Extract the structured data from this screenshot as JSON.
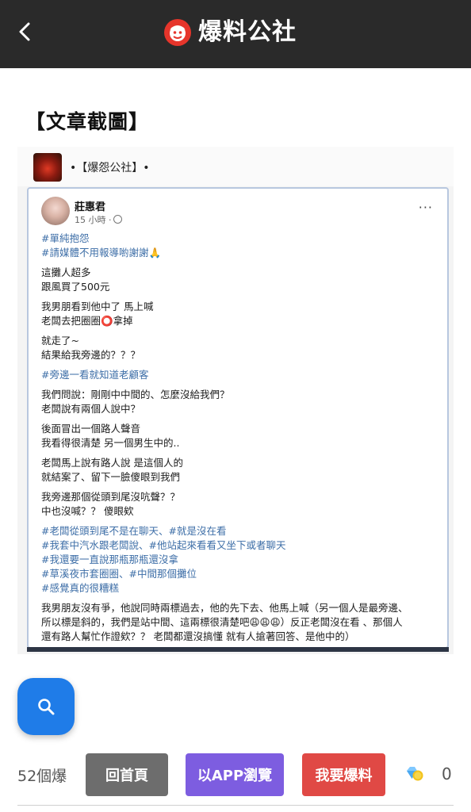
{
  "header": {
    "title": "爆料公社",
    "back_icon": "chevron-left-icon",
    "logo_icon": "brand-face-icon"
  },
  "section": {
    "title": "【文章截圖】"
  },
  "screenshot": {
    "group_name": "•【爆怨公社】•",
    "post": {
      "author": "莊惠君",
      "time": "15 小時 ·",
      "menu": "···",
      "lines": [
        {
          "text": "#單純抱怨",
          "type": "tag"
        },
        {
          "text": "#請媒體不用報導喲謝謝🙏",
          "type": "tag"
        },
        {
          "text": "",
          "type": "gap"
        },
        {
          "text": "這攤人超多",
          "type": "text"
        },
        {
          "text": "跟風買了500元",
          "type": "text"
        },
        {
          "text": "",
          "type": "gap"
        },
        {
          "text": "我男朋看到他中了 馬上喊",
          "type": "text"
        },
        {
          "text": "老闆去把圈圈⭕拿掉",
          "type": "text"
        },
        {
          "text": "",
          "type": "gap"
        },
        {
          "text": "就走了~",
          "type": "text"
        },
        {
          "text": "結果給我旁邊的？？？",
          "type": "text"
        },
        {
          "text": "",
          "type": "gap"
        },
        {
          "text": "#旁邊一看就知道老顧客",
          "type": "tag"
        },
        {
          "text": "",
          "type": "gap"
        },
        {
          "text": "我們問說：剛剛中中間的、怎麼沒給我們？",
          "type": "text"
        },
        {
          "text": "老闆說有兩個人說中？",
          "type": "text"
        },
        {
          "text": "",
          "type": "gap"
        },
        {
          "text": "後面冒出一個路人聲音",
          "type": "text"
        },
        {
          "text": "我看得很清楚 另一個男生中的..",
          "type": "text"
        },
        {
          "text": "",
          "type": "gap"
        },
        {
          "text": "老闆馬上說有路人說 是這個人的",
          "type": "text"
        },
        {
          "text": "就結案了、留下一臉傻眼到我們",
          "type": "text"
        },
        {
          "text": "",
          "type": "gap"
        },
        {
          "text": "我旁邊那個從頭到尾沒吭聲？？",
          "type": "text"
        },
        {
          "text": "中也沒喊？？ 傻眼欸",
          "type": "text"
        },
        {
          "text": "",
          "type": "gap"
        },
        {
          "text": "#老闆從頭到尾不是在聊天、#就是沒在看",
          "type": "tag"
        },
        {
          "text": "#我套中汽水跟老闆說、#他站起來看看又坐下或者聊天",
          "type": "tag"
        },
        {
          "text": "#我還要一直說那瓶那瓶還沒拿",
          "type": "tag"
        },
        {
          "text": "#草溪夜市套圈圈、#中間那個攤位",
          "type": "tag"
        },
        {
          "text": "#感覺真的很糟糕",
          "type": "tag"
        },
        {
          "text": "",
          "type": "gap"
        },
        {
          "text": "我男朋友沒有爭，他說同時兩標過去，他的先下去、他馬上喊（另一個人是最旁邊、",
          "type": "text"
        },
        {
          "text": "所以標是斜的，我們是站中間、這兩標很清楚吧😩😩😩）反正老闆沒在看 、那個人",
          "type": "text"
        },
        {
          "text": "還有路人幫忙作證欸？？ 老闆都還沒搞懂 就有人搶著回答、是他中的）",
          "type": "text"
        }
      ]
    }
  },
  "fab": {
    "icon": "search-icon"
  },
  "bottom_bar": {
    "count_label": "52個爆",
    "home_label": "回首頁",
    "app_label": "以APP瀏覽",
    "post_label": "我要爆料",
    "reward_icon": "diamond-coin-icon",
    "reward_count": "0"
  },
  "colors": {
    "header_bg": "#2a2a2a",
    "tag_blue": "#3d6ea7",
    "fab_blue": "#1f7ce8",
    "home_gray": "#6d6d6d",
    "app_purple": "#7d5de0",
    "post_red": "#e04945"
  }
}
